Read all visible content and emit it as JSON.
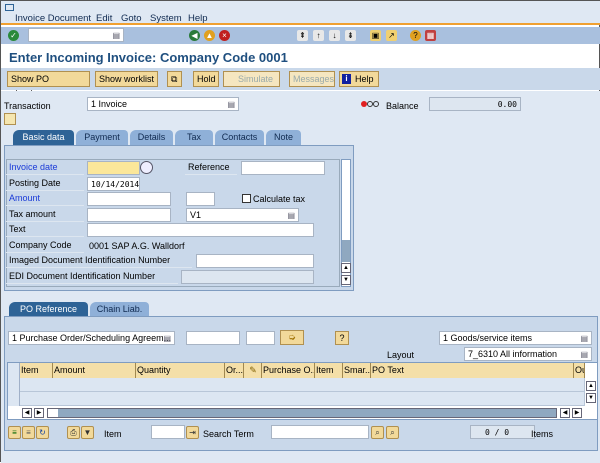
{
  "menu": {
    "items": [
      "Invoice Document",
      "Edit",
      "Goto",
      "System",
      "Help"
    ]
  },
  "title": "Enter Incoming Invoice: Company Code 0001",
  "app_toolbar": {
    "show_po": "Show PO structure",
    "show_worklist": "Show worklist",
    "hold": "Hold",
    "simulate": "Simulate",
    "messages": "Messages",
    "help": "Help"
  },
  "header": {
    "transaction_label": "Transaction",
    "transaction_value": "1 Invoice",
    "balance_label": "Balance",
    "balance_value": "0.00"
  },
  "tabs": [
    "Basic data",
    "Payment",
    "Details",
    "Tax",
    "Contacts",
    "Note"
  ],
  "basic": {
    "invoice_date": "Invoice date",
    "reference": "Reference",
    "posting_date": "Posting Date",
    "posting_value": "10/14/2014",
    "amount": "Amount",
    "calc_tax": "Calculate tax",
    "tax_amount": "Tax amount",
    "tax_code": "V1",
    "text": "Text",
    "company_code": "Company Code",
    "company_value": "0001 SAP A.G. Walldorf",
    "imaged": "Imaged Document Identification Number",
    "edi": "EDI Document Identification Number"
  },
  "lower_tabs": [
    "PO Reference",
    "Chain Liab."
  ],
  "po": {
    "ref_type": "1 Purchase Order/Scheduling Agreem...",
    "items_type": "1 Goods/service items",
    "layout_label": "Layout",
    "layout_value": "7_6310 All information"
  },
  "grid": {
    "columns": [
      "Item",
      "Amount",
      "Quantity",
      "Or...",
      "",
      "Purchase O...",
      "Item",
      "Smar...",
      "PO Text",
      "Ou"
    ]
  },
  "bottom": {
    "item_label": "Item",
    "search_label": "Search Term",
    "count": "0 / 0",
    "items_label": "Items"
  }
}
